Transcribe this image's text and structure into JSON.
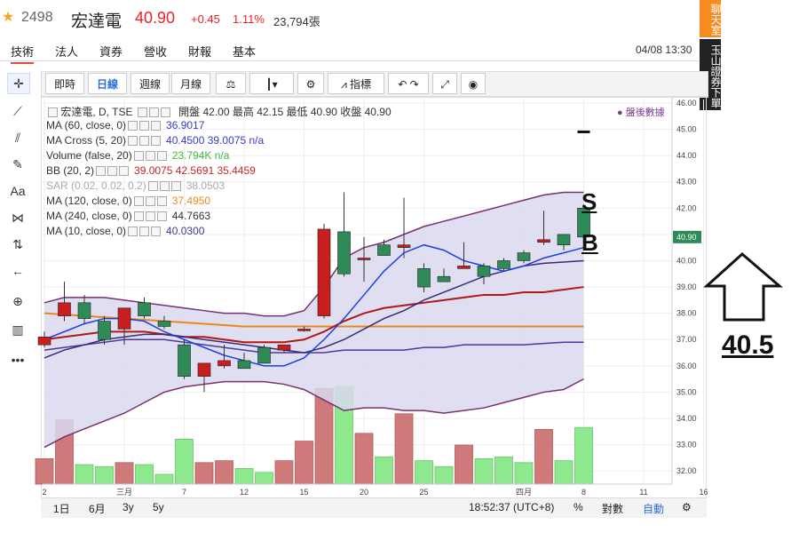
{
  "header": {
    "star_icon": "star-icon",
    "code": "2498",
    "name": "宏達電",
    "price": "40.90",
    "change": "+0.45",
    "change_pct": "1.11%",
    "volume": "23,794張"
  },
  "tabs": [
    "技術",
    "法人",
    "資券",
    "營收",
    "財報",
    "基本"
  ],
  "datetime": "04/08 13:30",
  "right_bar": {
    "chat": "聊天室",
    "order": "玉山證券下單"
  },
  "toolbar": {
    "buttons": [
      "即時",
      "日線",
      "週線",
      "月線"
    ],
    "indicators": "指標",
    "active": "日線"
  },
  "info": {
    "title": "宏達電, D, TSE",
    "ohlc": "開盤 42.00 最高 42.15 最低 40.90 收盤 40.90",
    "rows": [
      {
        "label": "MA (60, close, 0)",
        "values": "36.9017",
        "color": "#3a3ac8"
      },
      {
        "label": "MA Cross (5, 20)",
        "values": "40.4500 39.0075 n/a",
        "color": "#3a3ac8"
      },
      {
        "label": "Volume (false, 20)",
        "values": "23.794K n/a",
        "color": "#3db83d"
      },
      {
        "label": "BB (20, 2)",
        "values": "39.0075 42.5691 35.4459",
        "color": "#c0282d"
      },
      {
        "label": "SAR (0.02, 0.02, 0.2)",
        "values": "38.0503",
        "color": "#aaaaaa"
      },
      {
        "label": "MA (120, close, 0)",
        "values": "37.4950",
        "color": "#e8891c"
      },
      {
        "label": "MA (240, close, 0)",
        "values": "44.7663",
        "color": "#333333"
      },
      {
        "label": "MA (10, close, 0)",
        "values": "40.0300",
        "color": "#3a3a8f"
      }
    ]
  },
  "after_hours_label": "盤後數據",
  "annotations": {
    "s": "S",
    "b": "B",
    "value": "40.5"
  },
  "bottom": {
    "ranges": [
      "1日",
      "6月",
      "3y",
      "5y"
    ],
    "time": "18:52:37 (UTC+8)",
    "percent": "%",
    "log": "對數",
    "auto": "自動"
  },
  "chart_data": {
    "type": "candlestick",
    "ylim": [
      31.5,
      46.2
    ],
    "yticks": [
      32,
      33,
      34,
      35,
      36,
      37,
      38,
      39,
      40,
      41,
      42,
      43,
      44,
      45,
      46
    ],
    "last_price_label": "40.90",
    "xticks": [
      {
        "i": 0,
        "label": "2"
      },
      {
        "i": 4,
        "label": "三月"
      },
      {
        "i": 7,
        "label": "7"
      },
      {
        "i": 10,
        "label": "12"
      },
      {
        "i": 13,
        "label": "15"
      },
      {
        "i": 16,
        "label": "20"
      },
      {
        "i": 19,
        "label": "25"
      },
      {
        "i": 24,
        "label": "四月"
      },
      {
        "i": 27,
        "label": "8"
      },
      {
        "i": 30,
        "label": "11"
      },
      {
        "i": 33,
        "label": "16"
      }
    ],
    "candles": [
      {
        "o": 37.1,
        "h": 37.3,
        "l": 36.7,
        "c": 36.8,
        "v": 1.3,
        "up": false
      },
      {
        "o": 37.9,
        "h": 39.2,
        "l": 37.7,
        "c": 38.4,
        "v": 3.3,
        "up": false
      },
      {
        "o": 38.4,
        "h": 38.7,
        "l": 37.6,
        "c": 37.8,
        "v": 1.0,
        "up": true
      },
      {
        "o": 37.0,
        "h": 37.9,
        "l": 36.8,
        "c": 37.7,
        "v": 0.9,
        "up": true
      },
      {
        "o": 37.4,
        "h": 38.2,
        "l": 36.8,
        "c": 38.2,
        "v": 1.1,
        "up": false
      },
      {
        "o": 38.4,
        "h": 38.6,
        "l": 37.8,
        "c": 37.9,
        "v": 1.0,
        "up": true
      },
      {
        "o": 37.7,
        "h": 37.9,
        "l": 37.4,
        "c": 37.5,
        "v": 0.5,
        "up": true
      },
      {
        "o": 36.8,
        "h": 37.0,
        "l": 35.5,
        "c": 35.6,
        "v": 2.3,
        "up": true
      },
      {
        "o": 35.6,
        "h": 36.1,
        "l": 35.0,
        "c": 36.1,
        "v": 1.1,
        "up": false
      },
      {
        "o": 36.2,
        "h": 36.8,
        "l": 35.9,
        "c": 36.0,
        "v": 1.2,
        "up": false
      },
      {
        "o": 36.2,
        "h": 36.5,
        "l": 35.9,
        "c": 35.9,
        "v": 0.8,
        "up": true
      },
      {
        "o": 36.7,
        "h": 36.8,
        "l": 36.1,
        "c": 36.1,
        "v": 0.6,
        "up": true
      },
      {
        "o": 36.6,
        "h": 36.8,
        "l": 36.5,
        "c": 36.8,
        "v": 1.2,
        "up": false
      },
      {
        "o": 37.4,
        "h": 37.5,
        "l": 37.3,
        "c": 37.4,
        "v": 2.2,
        "up": false
      },
      {
        "o": 37.9,
        "h": 41.4,
        "l": 37.8,
        "c": 41.2,
        "v": 4.9,
        "up": false
      },
      {
        "o": 41.1,
        "h": 42.6,
        "l": 39.4,
        "c": 39.5,
        "v": 5.0,
        "up": true
      },
      {
        "o": 40.1,
        "h": 40.9,
        "l": 39.2,
        "c": 40.1,
        "v": 2.6,
        "up": false
      },
      {
        "o": 40.6,
        "h": 40.8,
        "l": 40.2,
        "c": 40.2,
        "v": 1.4,
        "up": true
      },
      {
        "o": 40.5,
        "h": 42.4,
        "l": 40.1,
        "c": 40.6,
        "v": 3.6,
        "up": false
      },
      {
        "o": 39.7,
        "h": 39.9,
        "l": 38.8,
        "c": 39.0,
        "v": 1.2,
        "up": true
      },
      {
        "o": 39.4,
        "h": 39.7,
        "l": 39.2,
        "c": 39.2,
        "v": 0.9,
        "up": true
      },
      {
        "o": 39.8,
        "h": 40.7,
        "l": 39.7,
        "c": 39.7,
        "v": 2.0,
        "up": false
      },
      {
        "o": 39.4,
        "h": 39.9,
        "l": 39.1,
        "c": 39.8,
        "v": 1.3,
        "up": true
      },
      {
        "o": 39.7,
        "h": 40.1,
        "l": 39.6,
        "c": 40.0,
        "v": 1.4,
        "up": true
      },
      {
        "o": 40.0,
        "h": 40.4,
        "l": 39.9,
        "c": 40.3,
        "v": 1.1,
        "up": true
      },
      {
        "o": 40.8,
        "h": 41.9,
        "l": 40.6,
        "c": 40.7,
        "v": 2.8,
        "up": false
      },
      {
        "o": 40.6,
        "h": 41.0,
        "l": 40.4,
        "c": 41.0,
        "v": 1.2,
        "up": true
      },
      {
        "o": 42.0,
        "h": 42.15,
        "l": 40.9,
        "c": 40.9,
        "v": 2.9,
        "up": true
      }
    ],
    "after_hours_mark": 44.9,
    "lines": {
      "bb_upper": [
        38.4,
        38.6,
        38.6,
        38.6,
        38.5,
        38.4,
        38.3,
        38.2,
        38.1,
        38.0,
        38.0,
        37.9,
        37.9,
        38.1,
        39.0,
        40.1,
        40.5,
        40.7,
        41.0,
        41.3,
        41.5,
        41.7,
        41.9,
        42.1,
        42.3,
        42.5,
        42.6,
        42.6
      ],
      "bb_lower": [
        32.9,
        33.3,
        33.6,
        33.9,
        34.2,
        34.6,
        35.0,
        35.2,
        35.3,
        35.4,
        35.4,
        35.4,
        35.3,
        35.1,
        34.7,
        34.3,
        34.4,
        34.4,
        34.3,
        34.3,
        34.2,
        34.3,
        34.4,
        34.6,
        34.8,
        35.0,
        35.1,
        35.5
      ],
      "bb_mid": [
        37.0,
        37.1,
        37.2,
        37.3,
        37.3,
        37.3,
        37.2,
        37.1,
        37.1,
        37.0,
        36.9,
        36.9,
        36.9,
        37.0,
        37.3,
        37.7,
        38.0,
        38.2,
        38.3,
        38.4,
        38.5,
        38.6,
        38.7,
        38.7,
        38.8,
        38.8,
        38.9,
        39.0
      ],
      "ma5": [
        37.0,
        37.3,
        37.6,
        37.8,
        37.8,
        37.7,
        37.3,
        37.0,
        36.7,
        36.4,
        36.2,
        36.0,
        36.0,
        36.3,
        37.0,
        37.8,
        38.7,
        39.6,
        40.3,
        40.6,
        40.4,
        40.0,
        39.8,
        39.6,
        39.8,
        40.1,
        40.3,
        40.5
      ],
      "ma20": [
        36.3,
        36.6,
        36.8,
        37.0,
        37.1,
        37.2,
        37.2,
        37.1,
        37.0,
        36.9,
        36.8,
        36.7,
        36.6,
        36.5,
        36.7,
        37.0,
        37.4,
        37.8,
        38.1,
        38.5,
        38.8,
        39.1,
        39.4,
        39.6,
        39.8,
        39.9,
        39.95,
        40.0
      ],
      "ma60": [
        36.6,
        36.7,
        36.8,
        36.9,
        37.0,
        37.0,
        37.0,
        36.9,
        36.8,
        36.7,
        36.6,
        36.5,
        36.5,
        36.5,
        36.5,
        36.6,
        36.6,
        36.6,
        36.6,
        36.7,
        36.7,
        36.8,
        36.8,
        36.8,
        36.8,
        36.85,
        36.9,
        36.9
      ],
      "ma120": [
        38.0,
        37.95,
        37.9,
        37.85,
        37.8,
        37.75,
        37.7,
        37.65,
        37.6,
        37.55,
        37.5,
        37.5,
        37.5,
        37.5,
        37.5,
        37.5,
        37.5,
        37.5,
        37.5,
        37.5,
        37.5,
        37.5,
        37.5,
        37.5,
        37.5,
        37.5,
        37.5,
        37.5
      ]
    },
    "colors": {
      "up": "#c81e1e",
      "down": "#2e8b57",
      "vol_up": "#cf7a7a",
      "vol_down": "#8ee88e",
      "bb": "#7a2f6e",
      "bb_fill": "#d9d9ee",
      "ma5": "#1f3fe0",
      "ma20": "#3a2a7a",
      "mid": "#b01818",
      "ma60": "#4a3a9a",
      "ma120": "#e8891c"
    }
  }
}
